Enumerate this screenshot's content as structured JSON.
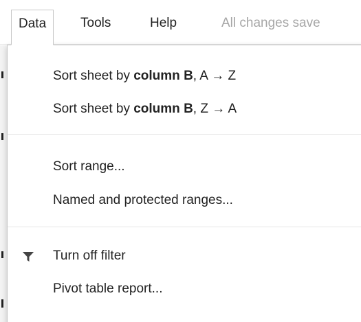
{
  "menubar": {
    "items": [
      {
        "label": "Data"
      },
      {
        "label": "Tools"
      },
      {
        "label": "Help"
      }
    ],
    "save_status": "All changes save"
  },
  "dropdown": {
    "sort_az": {
      "prefix": "Sort sheet by ",
      "bold": "column B",
      "suffix": ", A → Z"
    },
    "sort_za": {
      "prefix": "Sort sheet by ",
      "bold": "column B",
      "suffix": ", Z → A"
    },
    "sort_range": "Sort range...",
    "named_ranges": "Named and protected ranges...",
    "turn_off_filter": "Turn off filter",
    "filter_icon": "filter-icon",
    "pivot_table": "Pivot table report..."
  }
}
